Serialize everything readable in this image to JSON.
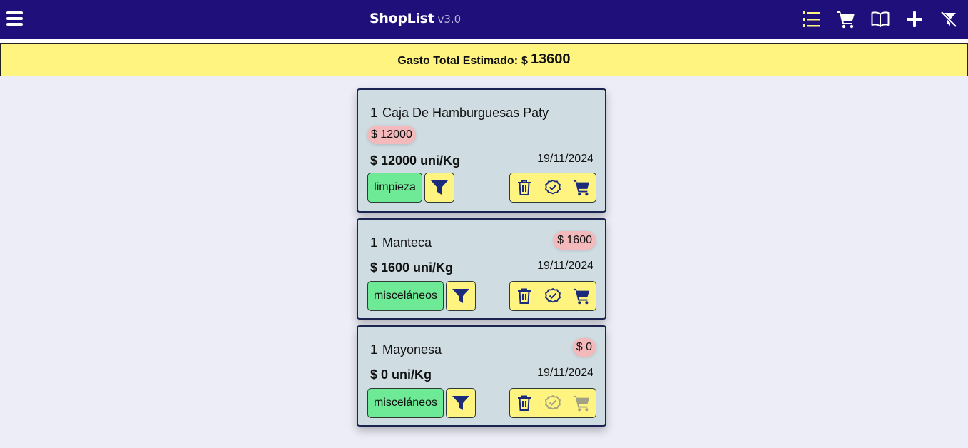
{
  "app": {
    "name": "ShopList",
    "version": "v3.0"
  },
  "header": {
    "icons": [
      "menu-icon",
      "list-icon",
      "cart-icon",
      "book-icon",
      "plus-icon",
      "filter-off-icon"
    ],
    "colors": {
      "bar": "#1f0f7a",
      "active_icon": "#fff480",
      "icon": "#ffffff"
    }
  },
  "summary": {
    "label": "Gasto Total Estimado:",
    "currency": "$",
    "amount": "13600"
  },
  "items": [
    {
      "qty": "1",
      "name": "Caja De Hamburguesas Paty",
      "price_badge": "$ 12000",
      "unit_price": "$ 12000 uni/Kg",
      "date": "19/11/2024",
      "category": "limpieza",
      "actions_enabled": true
    },
    {
      "qty": "1",
      "name": "Manteca",
      "price_badge": "$ 1600",
      "unit_price": "$ 1600 uni/Kg",
      "date": "19/11/2024",
      "category": "misceláneos",
      "actions_enabled": true
    },
    {
      "qty": "1",
      "name": "Mayonesa",
      "price_badge": "$ 0",
      "unit_price": "$ 0 uni/Kg",
      "date": "19/11/2024",
      "category": "misceláneos",
      "actions_enabled": false
    }
  ],
  "colors": {
    "card_bg": "#cfdce2",
    "price_badge": "#f4b9bb",
    "category": "#6ee996",
    "action_bg": "#fff480",
    "action_icon": "#1b2a7a",
    "action_disabled": "#a3a183"
  }
}
